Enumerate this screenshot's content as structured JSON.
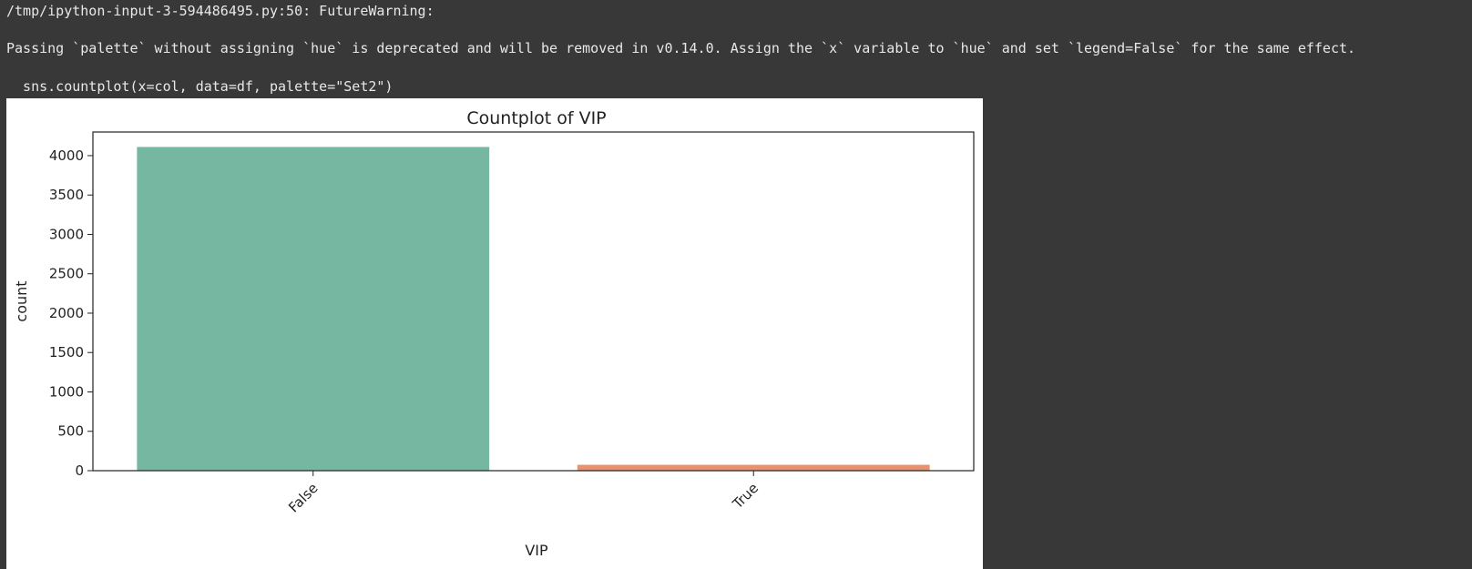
{
  "output": {
    "warning_header": "/tmp/ipython-input-3-594486495.py:50: FutureWarning:",
    "warning_message": "Passing `palette` without assigning `hue` is deprecated and will be removed in v0.14.0. Assign the `x` variable to `hue` and set `legend=False` for the same effect.",
    "warning_code": "  sns.countplot(x=col, data=df, palette=\"Set2\")"
  },
  "chart_data": {
    "type": "bar",
    "title": "Countplot of VIP",
    "xlabel": "VIP",
    "ylabel": "count",
    "categories": [
      "False",
      "True"
    ],
    "values": [
      4110,
      75
    ],
    "colors": [
      "#76b7a2",
      "#e8926f"
    ],
    "ylim": [
      0,
      4300
    ],
    "yticks": [
      0,
      500,
      1000,
      1500,
      2000,
      2500,
      3000,
      3500,
      4000
    ],
    "xtick_rotation": 45,
    "grid": false
  }
}
